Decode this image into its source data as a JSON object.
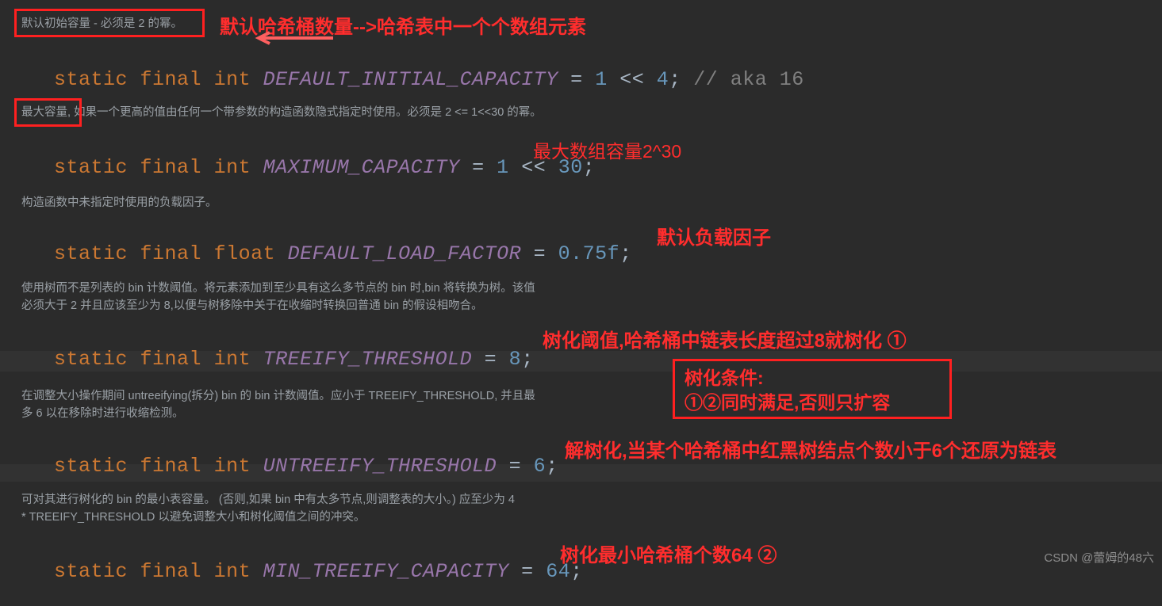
{
  "editor": {
    "background": "#2b2b2b",
    "accent_red": "#ff2020",
    "code_lines": [
      {
        "id": "default_initial_capacity",
        "segments": [
          {
            "t": "static",
            "c": "kw"
          },
          {
            "t": " ",
            "c": "op"
          },
          {
            "t": "final",
            "c": "kw"
          },
          {
            "t": " ",
            "c": "op"
          },
          {
            "t": "int",
            "c": "type"
          },
          {
            "t": " ",
            "c": "op"
          },
          {
            "t": "DEFAULT_INITIAL_CAPACITY",
            "c": "ident"
          },
          {
            "t": " = ",
            "c": "op"
          },
          {
            "t": "1",
            "c": "num"
          },
          {
            "t": " << ",
            "c": "op"
          },
          {
            "t": "4",
            "c": "num"
          },
          {
            "t": "; ",
            "c": "op"
          },
          {
            "t": "// aka 16",
            "c": "cmt"
          }
        ]
      },
      {
        "id": "maximum_capacity",
        "segments": [
          {
            "t": "static",
            "c": "kw"
          },
          {
            "t": " ",
            "c": "op"
          },
          {
            "t": "final",
            "c": "kw"
          },
          {
            "t": " ",
            "c": "op"
          },
          {
            "t": "int",
            "c": "type"
          },
          {
            "t": " ",
            "c": "op"
          },
          {
            "t": "MAXIMUM_CAPACITY",
            "c": "ident"
          },
          {
            "t": " = ",
            "c": "op"
          },
          {
            "t": "1",
            "c": "num"
          },
          {
            "t": " << ",
            "c": "op"
          },
          {
            "t": "30",
            "c": "num"
          },
          {
            "t": ";",
            "c": "op"
          }
        ]
      },
      {
        "id": "default_load_factor",
        "segments": [
          {
            "t": "static",
            "c": "kw"
          },
          {
            "t": " ",
            "c": "op"
          },
          {
            "t": "final",
            "c": "kw"
          },
          {
            "t": " ",
            "c": "op"
          },
          {
            "t": "float",
            "c": "type"
          },
          {
            "t": " ",
            "c": "op"
          },
          {
            "t": "DEFAULT_LOAD_FACTOR",
            "c": "ident"
          },
          {
            "t": " = ",
            "c": "op"
          },
          {
            "t": "0.75f",
            "c": "num"
          },
          {
            "t": ";",
            "c": "op"
          }
        ]
      },
      {
        "id": "treeify_threshold",
        "segments": [
          {
            "t": "static",
            "c": "kw"
          },
          {
            "t": " ",
            "c": "op"
          },
          {
            "t": "final",
            "c": "kw"
          },
          {
            "t": " ",
            "c": "op"
          },
          {
            "t": "int",
            "c": "type"
          },
          {
            "t": " ",
            "c": "op"
          },
          {
            "t": "TREEIFY_THRESHOLD",
            "c": "ident"
          },
          {
            "t": " = ",
            "c": "op"
          },
          {
            "t": "8",
            "c": "num"
          },
          {
            "t": ";",
            "c": "op"
          }
        ]
      },
      {
        "id": "untreeify_threshold",
        "segments": [
          {
            "t": "static",
            "c": "kw"
          },
          {
            "t": " ",
            "c": "op"
          },
          {
            "t": "final",
            "c": "kw"
          },
          {
            "t": " ",
            "c": "op"
          },
          {
            "t": "int",
            "c": "type"
          },
          {
            "t": " ",
            "c": "op"
          },
          {
            "t": "UNTREEIFY_THRESHOLD",
            "c": "ident"
          },
          {
            "t": " = ",
            "c": "op"
          },
          {
            "t": "6",
            "c": "num"
          },
          {
            "t": ";",
            "c": "op"
          }
        ]
      },
      {
        "id": "min_treeify_capacity",
        "segments": [
          {
            "t": "static",
            "c": "kw"
          },
          {
            "t": " ",
            "c": "op"
          },
          {
            "t": "final",
            "c": "kw"
          },
          {
            "t": " ",
            "c": "op"
          },
          {
            "t": "int",
            "c": "type"
          },
          {
            "t": " ",
            "c": "op"
          },
          {
            "t": "MIN_TREEIFY_CAPACITY",
            "c": "ident"
          },
          {
            "t": " = ",
            "c": "op"
          },
          {
            "t": "64",
            "c": "num"
          },
          {
            "t": ";",
            "c": "op"
          }
        ]
      }
    ],
    "doc_comments": [
      {
        "id": "doc-default-initial-capacity",
        "text": "默认初始容量 - 必须是 2 的幂。"
      },
      {
        "id": "doc-maximum-capacity",
        "text": "最大容量, 如果一个更高的值由任何一个带参数的构造函数隐式指定时使用。必须是 2 <= 1<<30 的幂。"
      },
      {
        "id": "doc-default-load-factor",
        "text": "构造函数中未指定时使用的负载因子。"
      },
      {
        "id": "doc-treeify-threshold",
        "text": "使用树而不是列表的 bin 计数阈值。将元素添加到至少具有这么多节点的 bin 时,bin 将转换为树。该值\n必须大于 2 并且应该至少为 8,以便与树移除中关于在收缩时转换回普通 bin 的假设相吻合。"
      },
      {
        "id": "doc-untreeify-threshold",
        "text": "在调整大小操作期间 untreeifying(拆分) bin 的 bin 计数阈值。应小于 TREEIFY_THRESHOLD, 并且最\n多 6 以在移除时进行收缩检测。"
      },
      {
        "id": "doc-min-treeify-capacity",
        "text": "可对其进行树化的 bin 的最小表容量。 (否则,如果 bin 中有太多节点,则调整表的大小。) 应至少为 4\n* TREEIFY_THRESHOLD 以避免调整大小和树化阈值之间的冲突。"
      }
    ],
    "annotations": [
      {
        "id": "anno-default-bucket-count",
        "text": "默认哈希桶数量-->哈希表中一个个数组元素"
      },
      {
        "id": "anno-max-array-capacity",
        "text": "最大数组容量2^30"
      },
      {
        "id": "anno-default-load-factor",
        "text": "默认负载因子"
      },
      {
        "id": "anno-treeify",
        "text": "树化阈值,哈希桶中链表长度超过8就树化 ①"
      },
      {
        "id": "anno-untreeify",
        "text": "解树化,当某个哈希桶中红黑树结点个数小于6个还原为链表"
      },
      {
        "id": "anno-min-treeify",
        "text": "树化最小哈希桶个数64 ②"
      }
    ],
    "callout": {
      "id": "callout-treeify-condition",
      "lines": [
        "树化条件:",
        "①②同时满足,否则只扩容"
      ]
    },
    "watermark": "CSDN @蕾姆的48六"
  }
}
